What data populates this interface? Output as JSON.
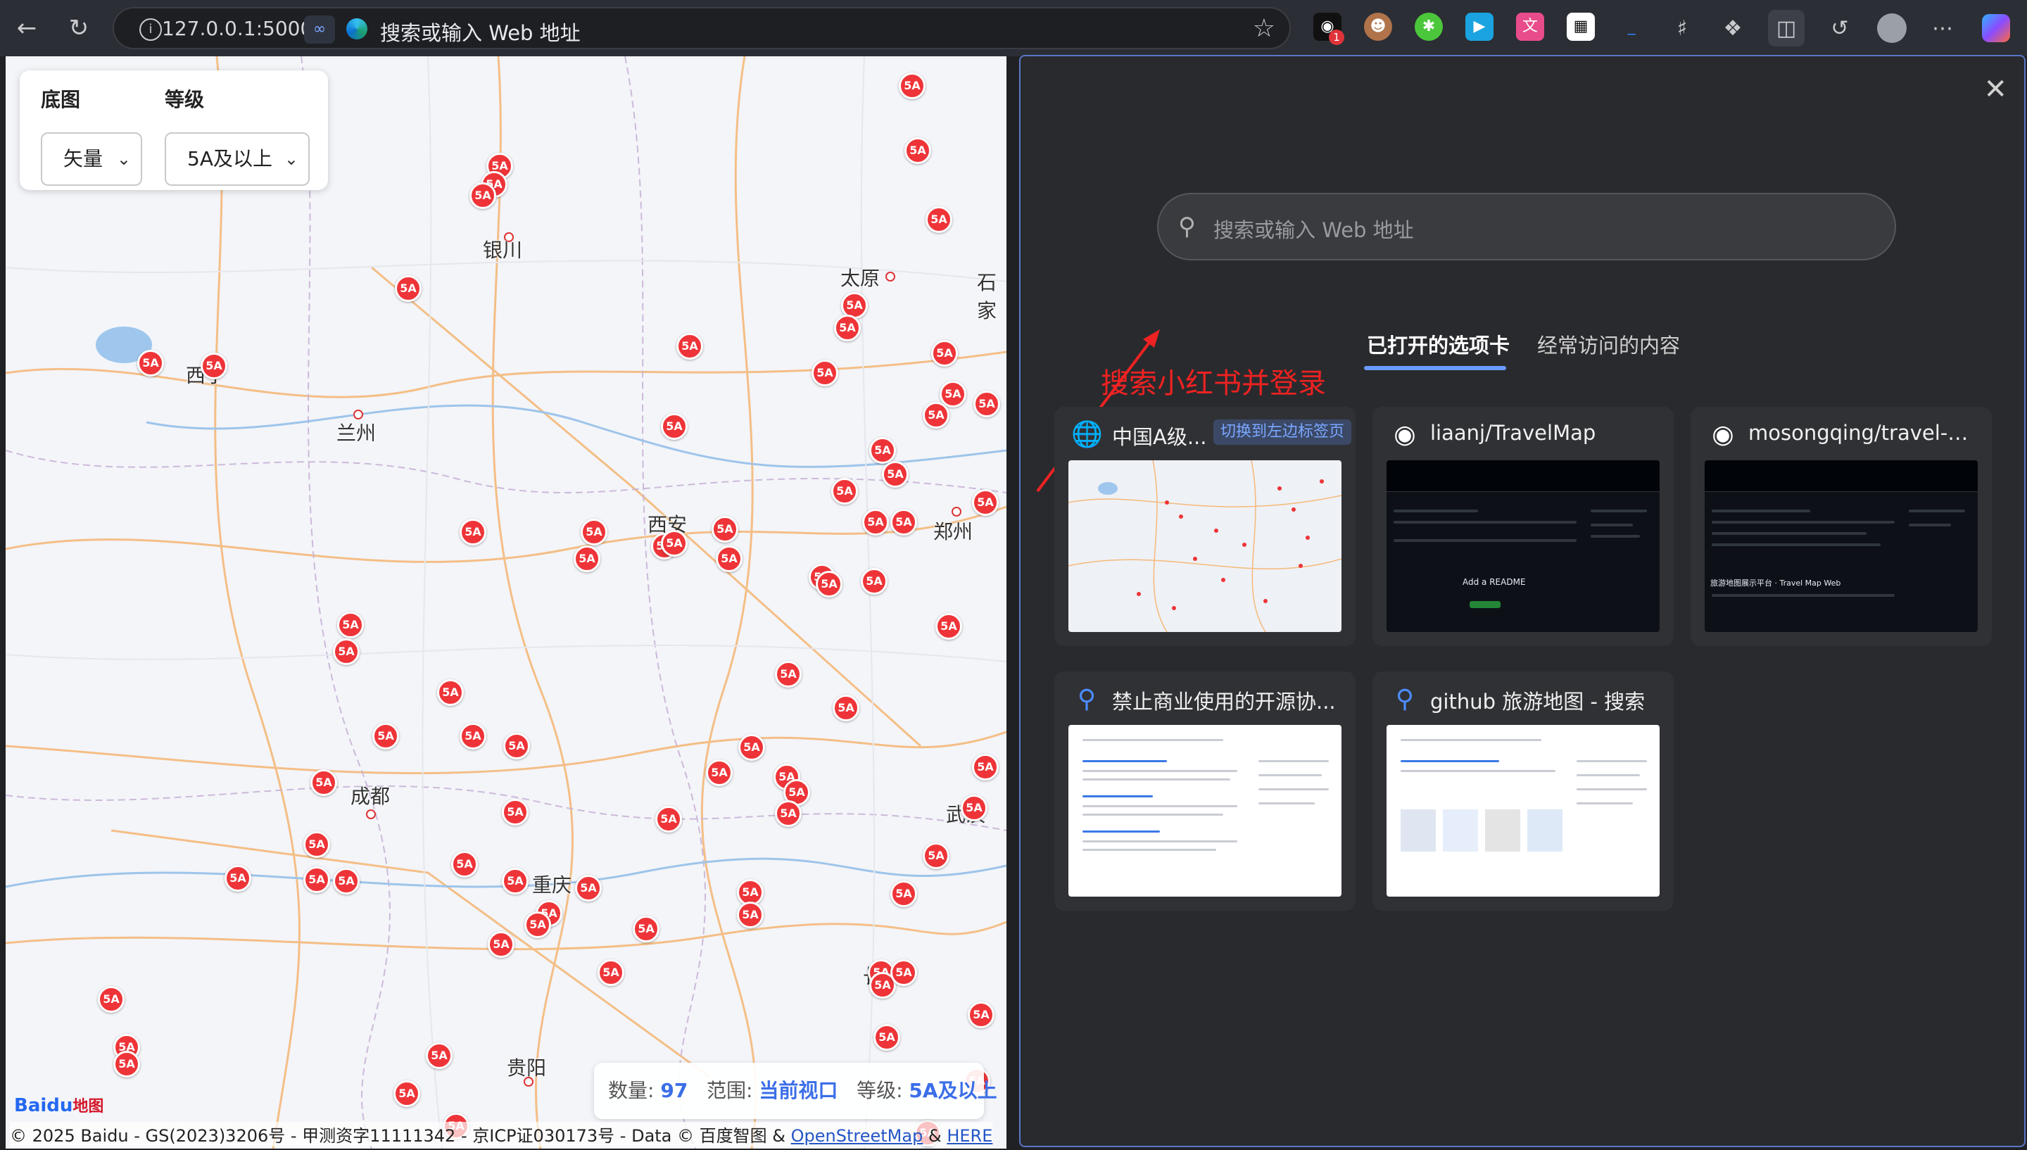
{
  "browser": {
    "url": "127.0.0.1:5000",
    "address_title": "搜索或输入 Web 地址",
    "ext_badge": "1"
  },
  "map": {
    "controls": {
      "basemap_label": "底图",
      "basemap_value": "矢量",
      "level_label": "等级",
      "level_value": "5A及以上"
    },
    "cities": [
      {
        "name": "银川"
      },
      {
        "name": "太原"
      },
      {
        "name": "石家"
      },
      {
        "name": "西宁"
      },
      {
        "name": "兰州"
      },
      {
        "name": "西安"
      },
      {
        "name": "郑州"
      },
      {
        "name": "成都"
      },
      {
        "name": "武汉"
      },
      {
        "name": "重庆"
      },
      {
        "name": "长沙"
      },
      {
        "name": "贵阳"
      }
    ],
    "poi_label": "5A",
    "status": {
      "count_label": "数量:",
      "count_value": "97",
      "range_label": "范围:",
      "range_value": "当前视口",
      "level_label": "等级:",
      "level_value": "5A及以上"
    },
    "logo_text_a": "Bai",
    "logo_text_b": "du",
    "logo_text_c": "地图",
    "copyright_prefix": "© 2025 Baidu - GS(2023)3206号 - 甲测资字11111342 - 京ICP证030173号 - Data © 百度智图 &",
    "copyright_osm": "OpenStreetMap",
    "copyright_amp": "&",
    "copyright_here": "HERE"
  },
  "panel": {
    "search_placeholder": "搜索或输入 Web 地址",
    "tab_open": "已打开的选项卡",
    "tab_frequent": "经常访问的内容",
    "annotation": "搜索小红书并登录",
    "cards": [
      {
        "title": "中国A级...",
        "switch_label": "切换到左边标签页",
        "icon": "globe-icon"
      },
      {
        "title": "liaanj/TravelMap",
        "icon": "github-icon"
      },
      {
        "title": "mosongqing/travel-ma...",
        "icon": "github-icon"
      },
      {
        "title": "禁止商业使用的开源协...",
        "icon": "search-icon"
      },
      {
        "title": "github 旅游地图 - 搜索",
        "icon": "search-icon"
      }
    ],
    "thumb_text": {
      "readme": "Add a README",
      "mos_heading": "旅游地图展示平台 · Travel Map Web"
    }
  },
  "colors": {
    "poi": "#ee3438",
    "accent": "#6a9bff",
    "annotation": "#ee2222"
  }
}
